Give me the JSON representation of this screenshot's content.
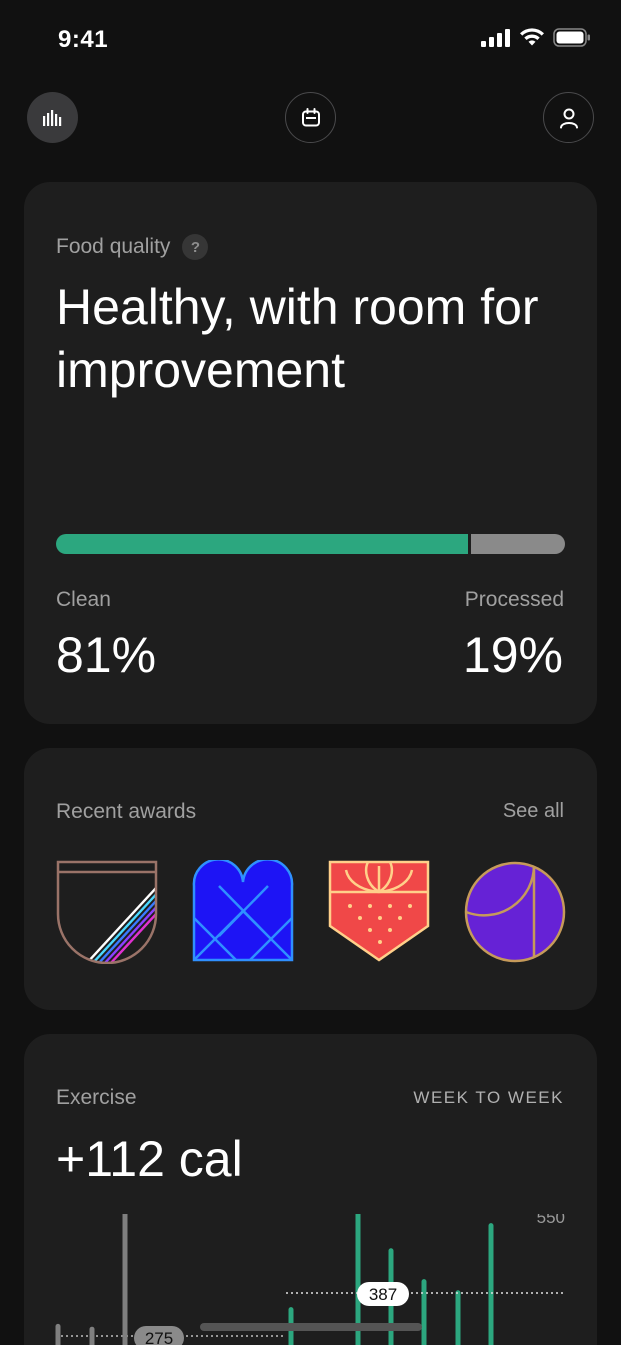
{
  "status_bar": {
    "time": "9:41"
  },
  "nav": {
    "stats_icon": "bar-chart-icon",
    "calendar_icon": "calendar-icon",
    "profile_icon": "person-icon"
  },
  "food_quality": {
    "label": "Food quality",
    "help": "?",
    "headline": "Healthy, with room for improvement",
    "clean_label": "Clean",
    "clean_value": "81%",
    "clean_fraction": 0.81,
    "processed_label": "Processed",
    "processed_value": "19%",
    "colors": {
      "clean": "#2ca77f",
      "processed": "#8a8a8a"
    }
  },
  "awards": {
    "label": "Recent awards",
    "see_all": "See all",
    "items": [
      "shield-stripes-badge",
      "heart-blue-badge",
      "strawberry-shield-badge",
      "purple-circle-badge"
    ]
  },
  "exercise": {
    "label": "Exercise",
    "range": "WEEK TO WEEK",
    "value": "+112 cal"
  },
  "chart_data": {
    "type": "bar",
    "reference_lines": [
      {
        "value": 550,
        "label": "550"
      },
      {
        "value": 387,
        "label": "387"
      },
      {
        "value": 275,
        "label": "275"
      }
    ],
    "series": [
      {
        "values": [
          245,
          240,
          585,
          170,
          205,
          190
        ]
      },
      {
        "values": [
          275,
          455,
          380,
          325,
          305,
          425
        ]
      }
    ],
    "colors": {
      "previous": "#7f7f7f",
      "current": "#2ca77f"
    },
    "ylim": [
      0,
      600
    ]
  }
}
